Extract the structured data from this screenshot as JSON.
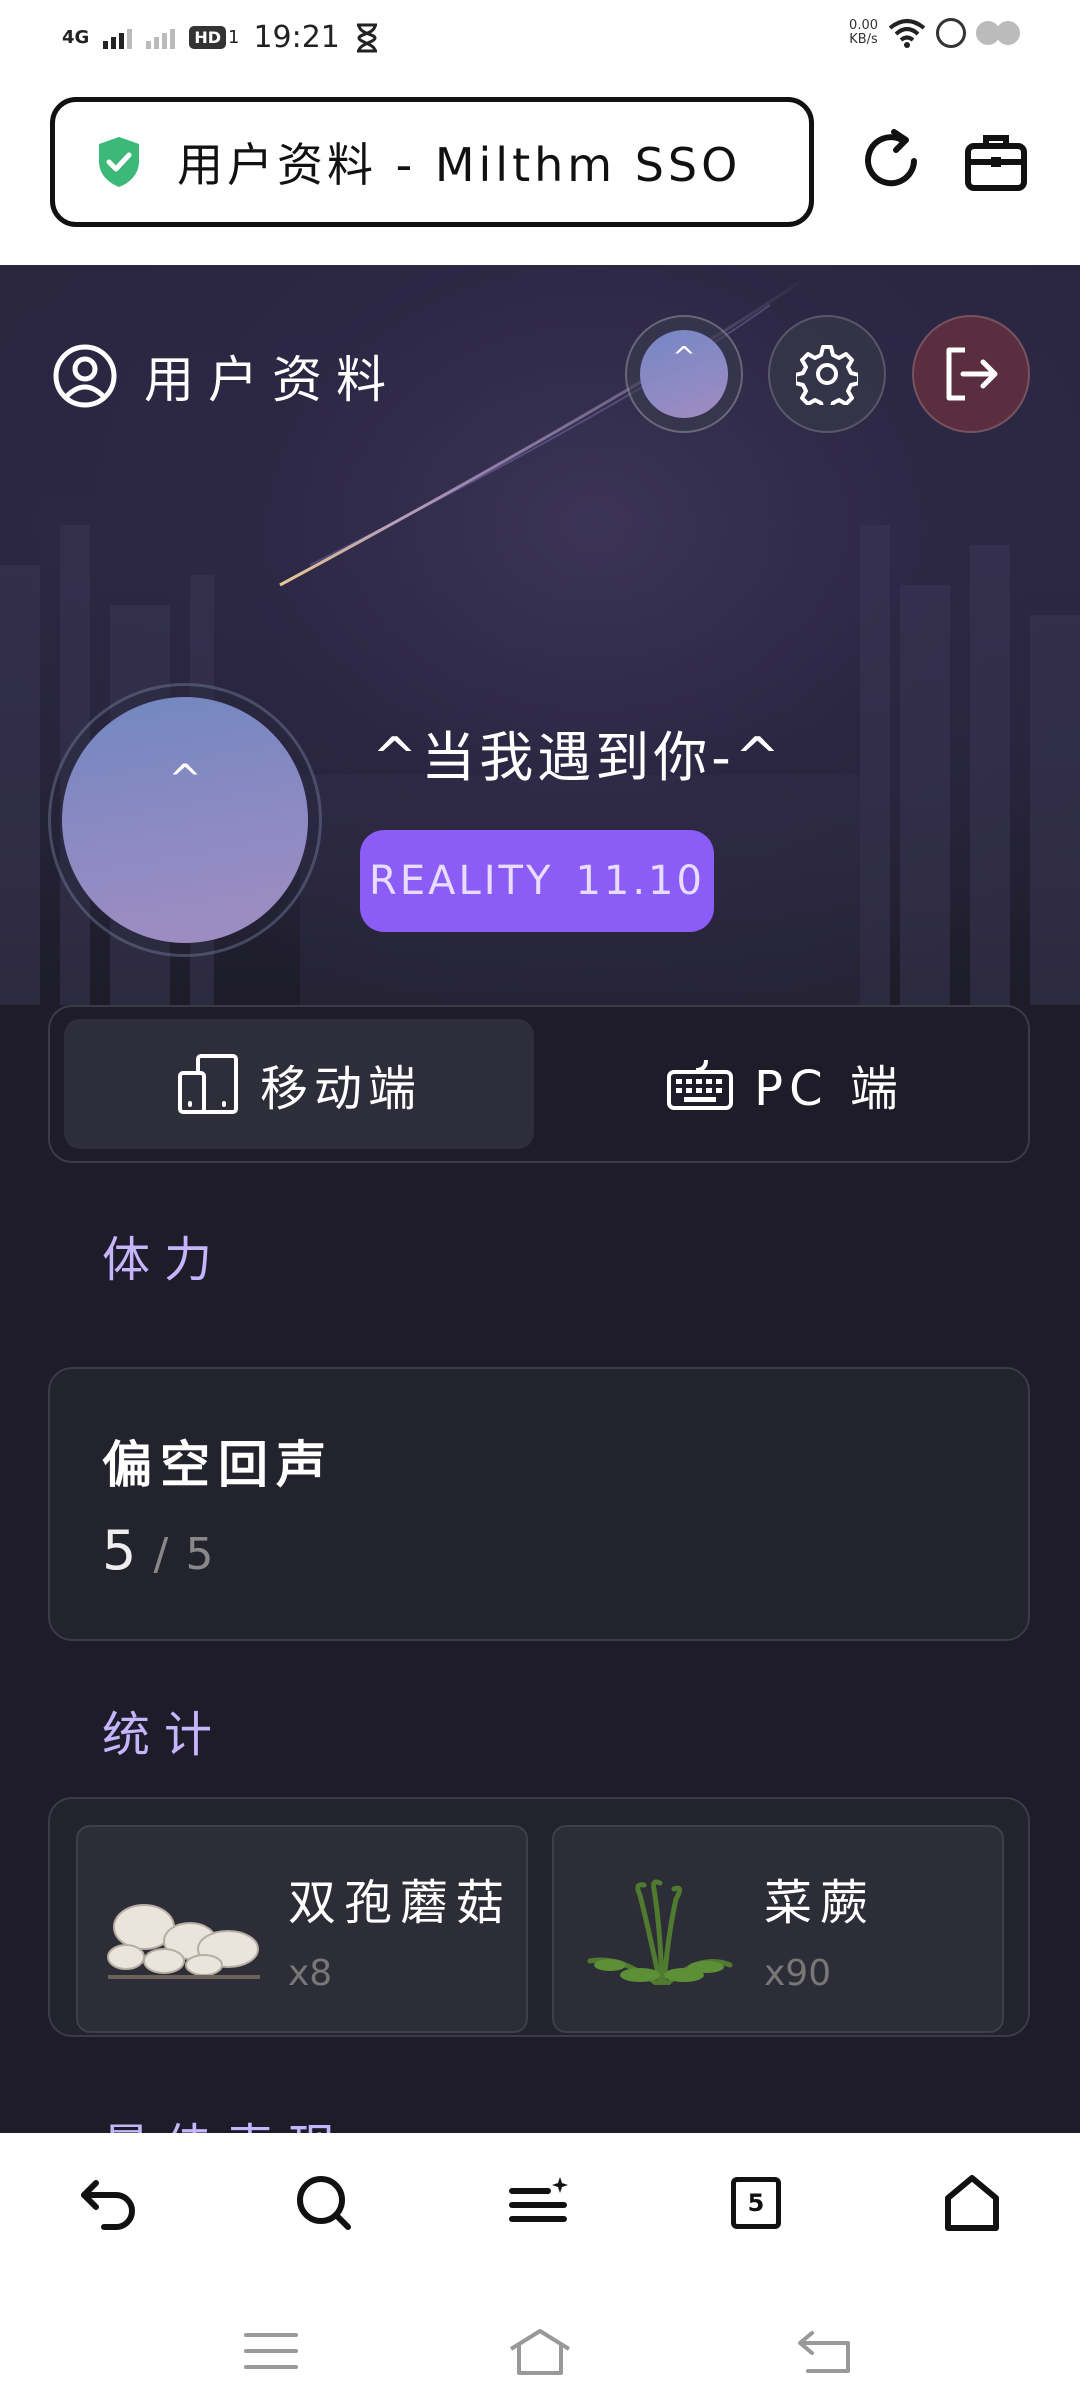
{
  "status_bar": {
    "network": "4G",
    "hd": "HD",
    "sim": "1",
    "time": "19:21",
    "speed_value": "0.00",
    "speed_unit": "KB/s"
  },
  "browser": {
    "address_title": "用户资料 - Milthm SSO",
    "tab_count": "5"
  },
  "header": {
    "title": "用户资料",
    "avatar_glyph": "^"
  },
  "profile": {
    "avatar_glyph": "^",
    "username": "^当我遇到你-^",
    "reality_label": "REALITY",
    "reality_value": "11.10"
  },
  "device_tabs": [
    {
      "label": "移动端",
      "icon": "mobile-devices-icon",
      "selected": true
    },
    {
      "label": "PC 端",
      "icon": "keyboard-icon",
      "selected": false
    }
  ],
  "stamina": {
    "section_title": "体力",
    "name": "偏空回声",
    "current": "5",
    "separator": "/",
    "max": "5"
  },
  "stats": {
    "section_title": "统计",
    "items": [
      {
        "name": "双孢蘑菇",
        "count": "x8",
        "icon": "mushroom-icon"
      },
      {
        "name": "菜蕨",
        "count": "x90",
        "icon": "fern-icon"
      }
    ]
  },
  "next_section_partial": "最佳表现",
  "colors": {
    "accent_purple": "#8b5cf6",
    "section_title": "#c4b5fd",
    "page_bg": "#1d1c28",
    "logout_bg": "#5a2d3f",
    "secure_green": "#3cb878"
  }
}
